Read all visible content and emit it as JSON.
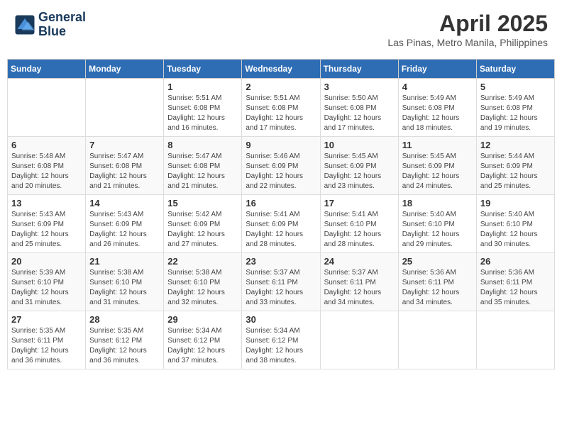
{
  "header": {
    "logo_line1": "General",
    "logo_line2": "Blue",
    "month_year": "April 2025",
    "location": "Las Pinas, Metro Manila, Philippines"
  },
  "weekdays": [
    "Sunday",
    "Monday",
    "Tuesday",
    "Wednesday",
    "Thursday",
    "Friday",
    "Saturday"
  ],
  "weeks": [
    [
      {
        "day": "",
        "info": ""
      },
      {
        "day": "",
        "info": ""
      },
      {
        "day": "1",
        "info": "Sunrise: 5:51 AM\nSunset: 6:08 PM\nDaylight: 12 hours\nand 16 minutes."
      },
      {
        "day": "2",
        "info": "Sunrise: 5:51 AM\nSunset: 6:08 PM\nDaylight: 12 hours\nand 17 minutes."
      },
      {
        "day": "3",
        "info": "Sunrise: 5:50 AM\nSunset: 6:08 PM\nDaylight: 12 hours\nand 17 minutes."
      },
      {
        "day": "4",
        "info": "Sunrise: 5:49 AM\nSunset: 6:08 PM\nDaylight: 12 hours\nand 18 minutes."
      },
      {
        "day": "5",
        "info": "Sunrise: 5:49 AM\nSunset: 6:08 PM\nDaylight: 12 hours\nand 19 minutes."
      }
    ],
    [
      {
        "day": "6",
        "info": "Sunrise: 5:48 AM\nSunset: 6:08 PM\nDaylight: 12 hours\nand 20 minutes."
      },
      {
        "day": "7",
        "info": "Sunrise: 5:47 AM\nSunset: 6:08 PM\nDaylight: 12 hours\nand 21 minutes."
      },
      {
        "day": "8",
        "info": "Sunrise: 5:47 AM\nSunset: 6:08 PM\nDaylight: 12 hours\nand 21 minutes."
      },
      {
        "day": "9",
        "info": "Sunrise: 5:46 AM\nSunset: 6:09 PM\nDaylight: 12 hours\nand 22 minutes."
      },
      {
        "day": "10",
        "info": "Sunrise: 5:45 AM\nSunset: 6:09 PM\nDaylight: 12 hours\nand 23 minutes."
      },
      {
        "day": "11",
        "info": "Sunrise: 5:45 AM\nSunset: 6:09 PM\nDaylight: 12 hours\nand 24 minutes."
      },
      {
        "day": "12",
        "info": "Sunrise: 5:44 AM\nSunset: 6:09 PM\nDaylight: 12 hours\nand 25 minutes."
      }
    ],
    [
      {
        "day": "13",
        "info": "Sunrise: 5:43 AM\nSunset: 6:09 PM\nDaylight: 12 hours\nand 25 minutes."
      },
      {
        "day": "14",
        "info": "Sunrise: 5:43 AM\nSunset: 6:09 PM\nDaylight: 12 hours\nand 26 minutes."
      },
      {
        "day": "15",
        "info": "Sunrise: 5:42 AM\nSunset: 6:09 PM\nDaylight: 12 hours\nand 27 minutes."
      },
      {
        "day": "16",
        "info": "Sunrise: 5:41 AM\nSunset: 6:09 PM\nDaylight: 12 hours\nand 28 minutes."
      },
      {
        "day": "17",
        "info": "Sunrise: 5:41 AM\nSunset: 6:10 PM\nDaylight: 12 hours\nand 28 minutes."
      },
      {
        "day": "18",
        "info": "Sunrise: 5:40 AM\nSunset: 6:10 PM\nDaylight: 12 hours\nand 29 minutes."
      },
      {
        "day": "19",
        "info": "Sunrise: 5:40 AM\nSunset: 6:10 PM\nDaylight: 12 hours\nand 30 minutes."
      }
    ],
    [
      {
        "day": "20",
        "info": "Sunrise: 5:39 AM\nSunset: 6:10 PM\nDaylight: 12 hours\nand 31 minutes."
      },
      {
        "day": "21",
        "info": "Sunrise: 5:38 AM\nSunset: 6:10 PM\nDaylight: 12 hours\nand 31 minutes."
      },
      {
        "day": "22",
        "info": "Sunrise: 5:38 AM\nSunset: 6:10 PM\nDaylight: 12 hours\nand 32 minutes."
      },
      {
        "day": "23",
        "info": "Sunrise: 5:37 AM\nSunset: 6:11 PM\nDaylight: 12 hours\nand 33 minutes."
      },
      {
        "day": "24",
        "info": "Sunrise: 5:37 AM\nSunset: 6:11 PM\nDaylight: 12 hours\nand 34 minutes."
      },
      {
        "day": "25",
        "info": "Sunrise: 5:36 AM\nSunset: 6:11 PM\nDaylight: 12 hours\nand 34 minutes."
      },
      {
        "day": "26",
        "info": "Sunrise: 5:36 AM\nSunset: 6:11 PM\nDaylight: 12 hours\nand 35 minutes."
      }
    ],
    [
      {
        "day": "27",
        "info": "Sunrise: 5:35 AM\nSunset: 6:11 PM\nDaylight: 12 hours\nand 36 minutes."
      },
      {
        "day": "28",
        "info": "Sunrise: 5:35 AM\nSunset: 6:12 PM\nDaylight: 12 hours\nand 36 minutes."
      },
      {
        "day": "29",
        "info": "Sunrise: 5:34 AM\nSunset: 6:12 PM\nDaylight: 12 hours\nand 37 minutes."
      },
      {
        "day": "30",
        "info": "Sunrise: 5:34 AM\nSunset: 6:12 PM\nDaylight: 12 hours\nand 38 minutes."
      },
      {
        "day": "",
        "info": ""
      },
      {
        "day": "",
        "info": ""
      },
      {
        "day": "",
        "info": ""
      }
    ]
  ]
}
